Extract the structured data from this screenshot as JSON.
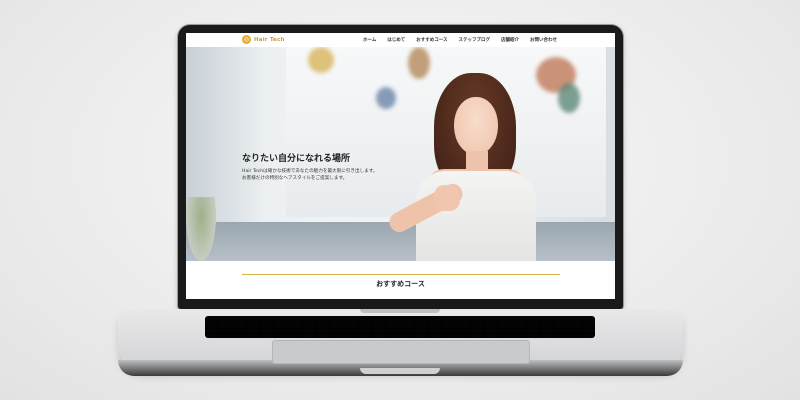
{
  "site": {
    "logo_text": "Hair Tech",
    "nav": [
      "ホーム",
      "はじめて",
      "おすすめコース",
      "ステッフブログ",
      "店舗紹介",
      "お問い合わせ"
    ],
    "hero": {
      "title": "なりたい自分になれる場所",
      "subtitle_line1": "Hair Techは確かな技術であなたの魅力を最大限に引き出します。",
      "subtitle_line2": "お客様だけの特別なヘアスタイルをご提案します。"
    },
    "section_title": "おすすめコース"
  },
  "colors": {
    "accent": "#d8b24a",
    "logo": "#e5a92e"
  }
}
